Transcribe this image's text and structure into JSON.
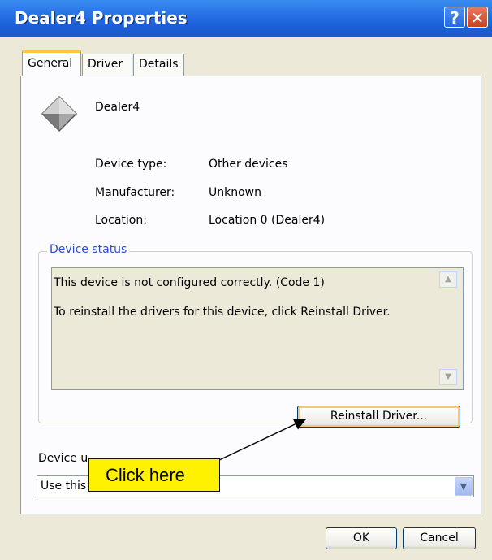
{
  "window": {
    "title": "Dealer4 Properties"
  },
  "tabs": [
    {
      "label": "General"
    },
    {
      "label": "Driver"
    },
    {
      "label": "Details"
    }
  ],
  "device": {
    "name": "Dealer4",
    "icon": "unknown-device-icon"
  },
  "properties": [
    {
      "label": "Device type:",
      "value": "Other devices"
    },
    {
      "label": "Manufacturer:",
      "value": "Unknown"
    },
    {
      "label": "Location:",
      "value": "Location 0 (Dealer4)"
    }
  ],
  "device_status": {
    "legend": "Device status",
    "lines": [
      "This device is not configured correctly. (Code 1)",
      "To reinstall the drivers for this device, click Reinstall Driver."
    ],
    "reinstall_button": "Reinstall Driver..."
  },
  "device_usage": {
    "label": "Device u",
    "value": "Use this"
  },
  "callout": {
    "text": "Click here",
    "color": "#fff200"
  },
  "buttons": {
    "ok": "OK",
    "cancel": "Cancel"
  },
  "title_buttons": {
    "help": "?",
    "close": "✕"
  }
}
